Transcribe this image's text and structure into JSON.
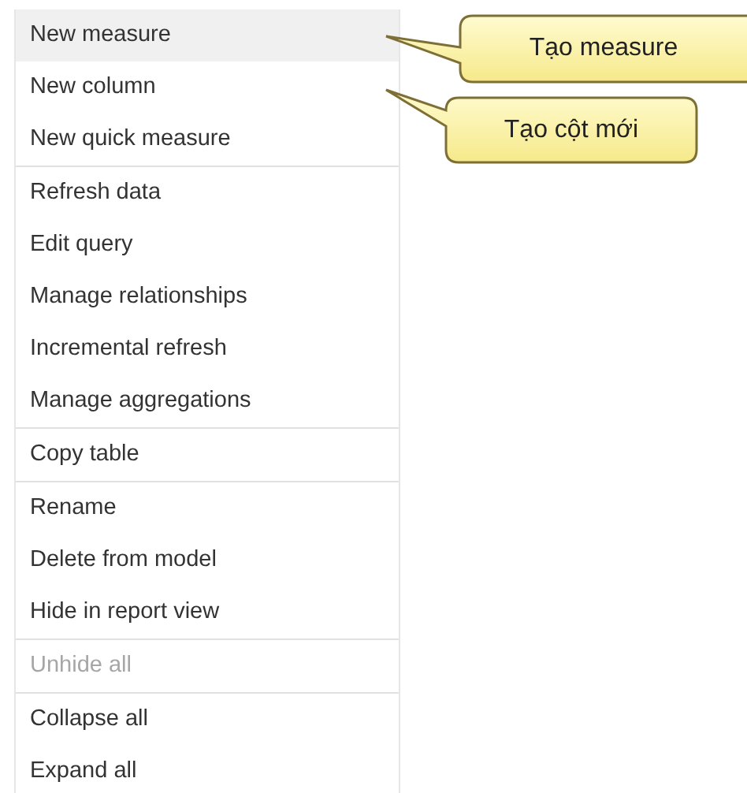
{
  "menu": {
    "groups": [
      {
        "items": [
          {
            "label": "New measure",
            "selected": true,
            "disabled": false
          },
          {
            "label": "New column",
            "selected": false,
            "disabled": false
          },
          {
            "label": "New quick measure",
            "selected": false,
            "disabled": false
          }
        ]
      },
      {
        "items": [
          {
            "label": "Refresh data",
            "selected": false,
            "disabled": false
          },
          {
            "label": "Edit query",
            "selected": false,
            "disabled": false
          },
          {
            "label": "Manage relationships",
            "selected": false,
            "disabled": false
          },
          {
            "label": "Incremental refresh",
            "selected": false,
            "disabled": false
          },
          {
            "label": "Manage aggregations",
            "selected": false,
            "disabled": false
          }
        ]
      },
      {
        "items": [
          {
            "label": "Copy table",
            "selected": false,
            "disabled": false
          }
        ]
      },
      {
        "items": [
          {
            "label": "Rename",
            "selected": false,
            "disabled": false
          },
          {
            "label": "Delete from model",
            "selected": false,
            "disabled": false
          },
          {
            "label": "Hide in report view",
            "selected": false,
            "disabled": false
          }
        ]
      },
      {
        "items": [
          {
            "label": "Unhide all",
            "selected": false,
            "disabled": true
          }
        ]
      },
      {
        "items": [
          {
            "label": "Collapse all",
            "selected": false,
            "disabled": false
          },
          {
            "label": "Expand all",
            "selected": false,
            "disabled": false
          }
        ]
      }
    ]
  },
  "callouts": [
    {
      "text": "Tạo measure"
    },
    {
      "text": "Tạo cột mới"
    }
  ]
}
